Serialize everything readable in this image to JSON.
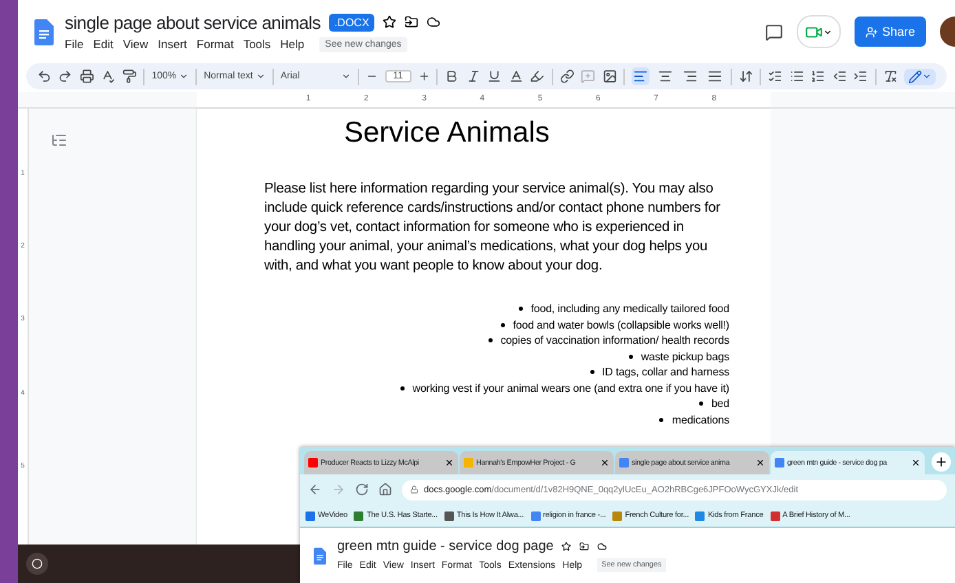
{
  "docs_window": {
    "title": "single page about service animals",
    "badge": ".DOCX",
    "starred": false,
    "menu": [
      "File",
      "Edit",
      "View",
      "Insert",
      "Format",
      "Tools",
      "Help"
    ],
    "see_changes": "See new changes",
    "share": "Share"
  },
  "toolbar": {
    "zoom": "100%",
    "style": "Normal text",
    "font": "Arial",
    "font_size": "11",
    "alignments": [
      {
        "kind": "left",
        "selected": true
      },
      {
        "kind": "center",
        "selected": false
      },
      {
        "kind": "right",
        "selected": false
      },
      {
        "kind": "justify",
        "selected": false
      }
    ]
  },
  "ruler": [
    "1",
    "2",
    "3",
    "4",
    "5",
    "6",
    "7",
    "8"
  ],
  "vertical_ruler": [
    "1",
    "2",
    "3",
    "4",
    "5"
  ],
  "document": {
    "heading": "Service Animals",
    "paragraph": "Please list here information regarding your service animal(s). You may also include quick reference cards/instructions and/or contact phone numbers for your dog’s vet, contact information for someone who is experienced in handling your animal, your animal’s medications, what your dog helps you with, and what you want people to know about your dog.",
    "bullets": [
      "food, including any medically tailored food",
      "food and water bowls (collapsible works well!)",
      "copies of vaccination information/ health records",
      "waste pickup bags",
      "ID tags, collar and harness",
      "working vest if your animal wears one (and extra one if you have it)",
      "bed",
      "medications"
    ]
  },
  "browser_window": {
    "tabs": [
      {
        "title": "Producer Reacts to Lizzy McAlpi",
        "kind": "video",
        "selected": false
      },
      {
        "title": "Hannah's EmpowHer Project - G",
        "kind": "slides",
        "selected": false
      },
      {
        "title": "single page about service anima",
        "kind": "doc",
        "selected": false
      },
      {
        "title": "green mtn guide - service dog pa",
        "kind": "doc",
        "selected": true
      }
    ],
    "url_host": "docs.google.com",
    "url_path": "/document/d/1v82H9QNE_0qq2ylUcEu_AO2hRBCge6JPFOoWycGYXJk/edit",
    "bookmarks": [
      {
        "label": "WeVideo",
        "color": "#1a73e8"
      },
      {
        "label": "The U.S. Has Starte...",
        "color": "#2e7d32"
      },
      {
        "label": "This Is How It Alwa...",
        "color": "#555555"
      },
      {
        "label": "religion in france -...",
        "color": "#4285f4"
      },
      {
        "label": "French Culture for...",
        "color": "#b8860b"
      },
      {
        "label": "Kids from France",
        "color": "#1e88e5"
      },
      {
        "label": "A Brief History of M...",
        "color": "#d32f2f"
      }
    ],
    "doc": {
      "title": "green mtn guide - service dog page",
      "starred": false,
      "menu": [
        "File",
        "Edit",
        "View",
        "Insert",
        "Format",
        "Tools",
        "Extensions",
        "Help"
      ],
      "see_changes": "See new changes"
    }
  }
}
